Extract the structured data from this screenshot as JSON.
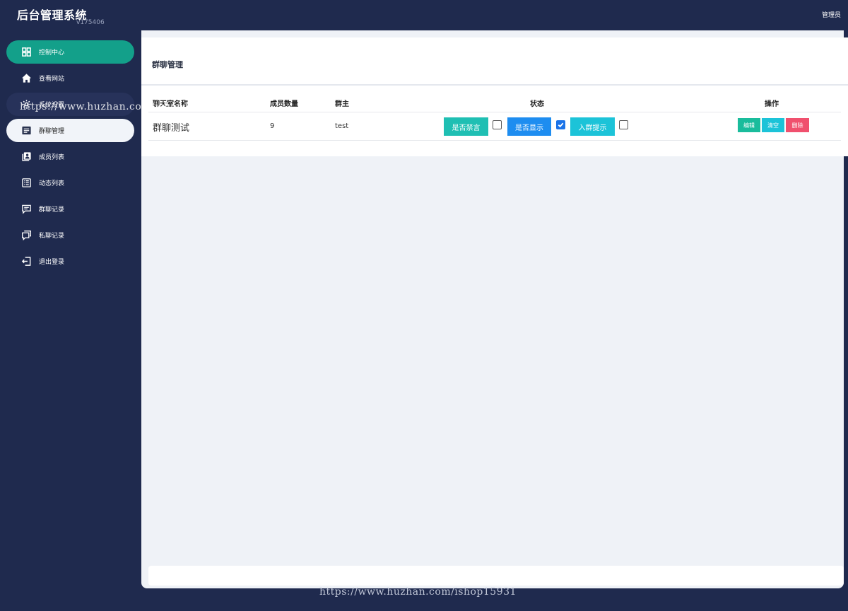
{
  "header": {
    "title": "后台管理系统",
    "version": "v175406",
    "user": "管理员"
  },
  "sidebar": {
    "items": [
      {
        "label": "控制中心",
        "icon": "dashboard-grid-icon"
      },
      {
        "label": "查看网站",
        "icon": "home-icon"
      },
      {
        "label": "系统设置",
        "icon": "gear-icon"
      },
      {
        "label": "群聊管理",
        "icon": "message-list-icon"
      },
      {
        "label": "成员列表",
        "icon": "contacts-icon"
      },
      {
        "label": "动态列表",
        "icon": "list-box-icon"
      },
      {
        "label": "群聊记录",
        "icon": "chat-bubble-icon"
      },
      {
        "label": "私聊记录",
        "icon": "chat-bubbles-icon"
      },
      {
        "label": "退出登录",
        "icon": "logout-icon"
      }
    ]
  },
  "main": {
    "title": "群聊管理",
    "columns": [
      "聊天室名称",
      "成员数量",
      "群主",
      "状态",
      "操作"
    ],
    "rows": [
      {
        "name": "群聊测试",
        "members": "9",
        "owner": "test",
        "status": [
          {
            "label": "是否禁言",
            "checked": false
          },
          {
            "label": "是否显示",
            "checked": true
          },
          {
            "label": "入群提示",
            "checked": false
          }
        ],
        "actions": [
          "编辑",
          "清空",
          "删除"
        ]
      }
    ]
  },
  "watermark": "https://www.huzhan.com/ishop15931",
  "colors": {
    "sidebar_bg": "#1f2a4e",
    "accent_green": "#13a08a",
    "content_bg": "#eff2f7",
    "btn_blue": "#1e8df0",
    "btn_red": "#f0506e"
  }
}
